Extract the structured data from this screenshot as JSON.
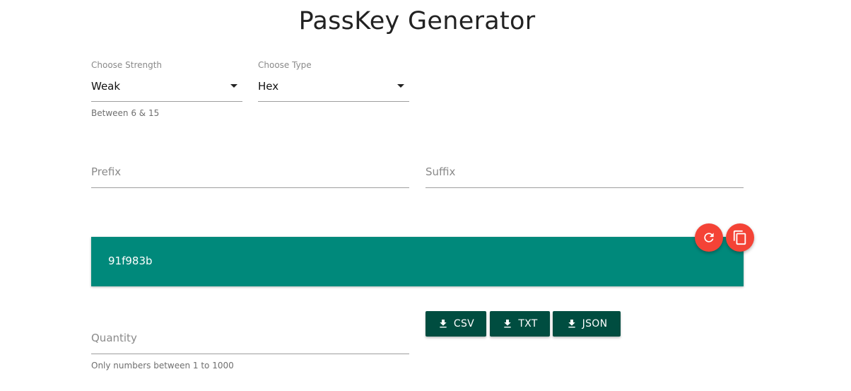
{
  "title": "PassKey Generator",
  "strength": {
    "label": "Choose Strength",
    "value": "Weak",
    "helper": "Between 6 & 15"
  },
  "type": {
    "label": "Choose Type",
    "value": "Hex"
  },
  "prefix": {
    "placeholder": "Prefix",
    "value": ""
  },
  "suffix": {
    "placeholder": "Suffix",
    "value": ""
  },
  "generated_key": "91f983b",
  "actions": {
    "refresh_icon": "refresh-icon",
    "copy_icon": "copy-icon"
  },
  "quantity": {
    "placeholder": "Quantity",
    "helper": "Only numbers between 1 to 1000"
  },
  "downloads": [
    {
      "label": "CSV",
      "icon": "download-icon"
    },
    {
      "label": "TXT",
      "icon": "download-icon"
    },
    {
      "label": "JSON",
      "icon": "download-icon"
    }
  ],
  "colors": {
    "key_bg": "#00897b",
    "fab": "#f44336",
    "download_bg": "#004d40"
  }
}
